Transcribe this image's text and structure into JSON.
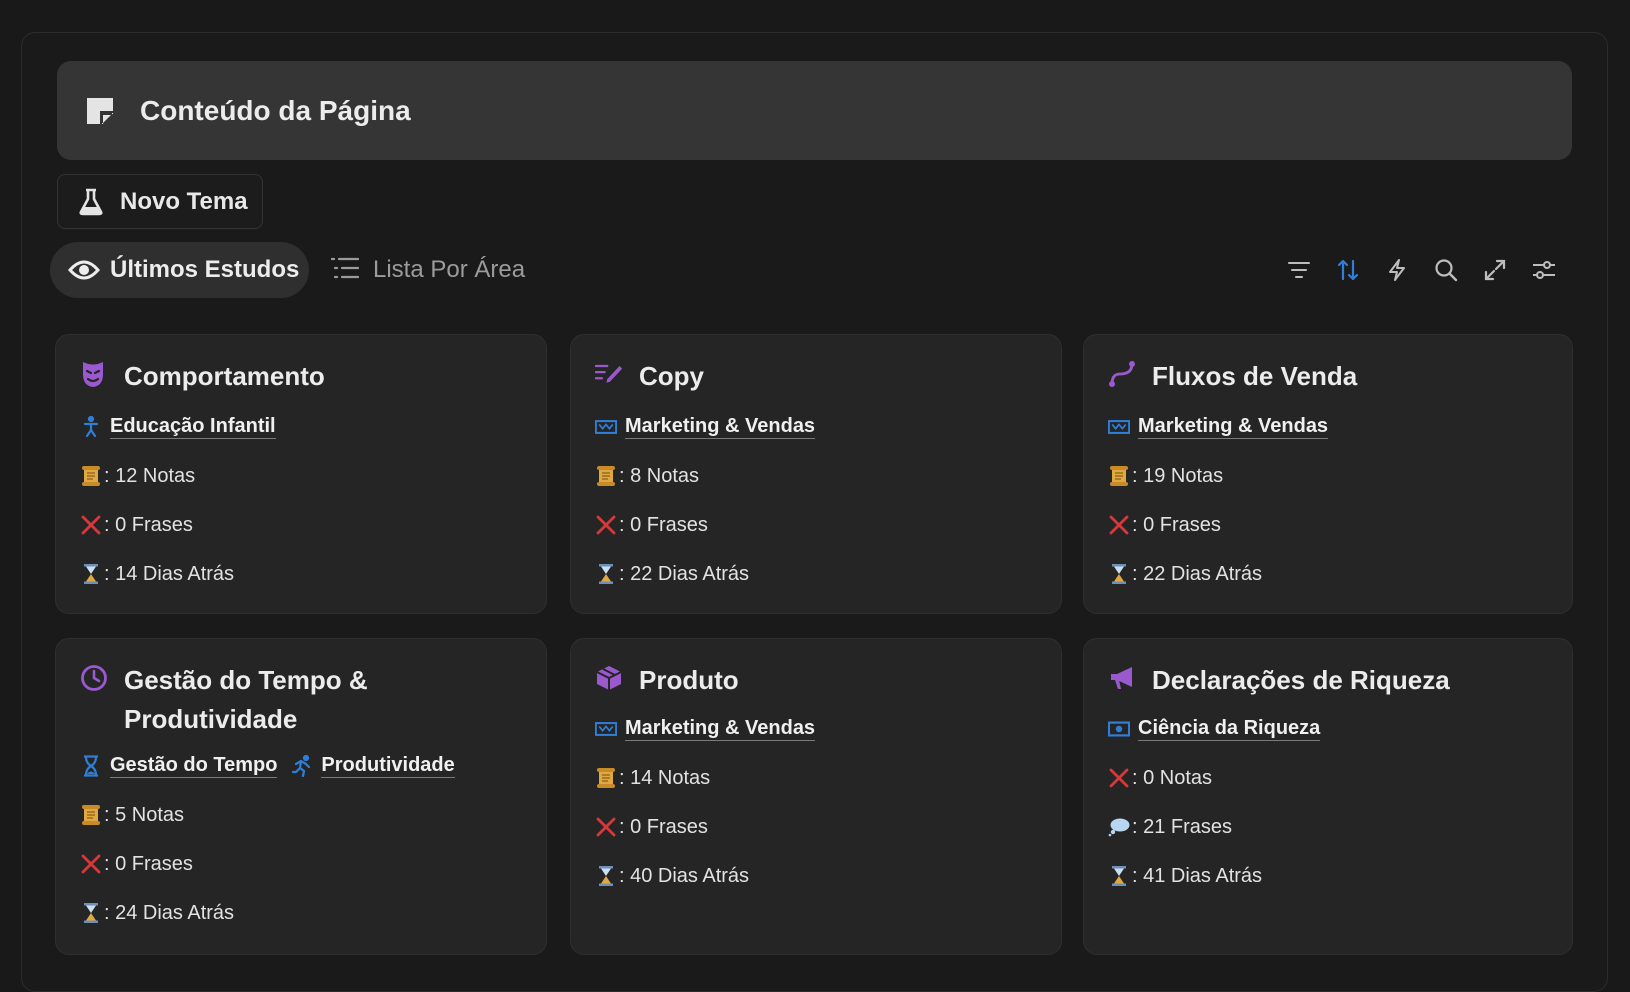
{
  "callout": {
    "title": "Conteúdo da Página",
    "icon": "sticky-note-icon"
  },
  "new_button": {
    "label": "Novo Tema",
    "icon": "flask-icon"
  },
  "tabs": [
    {
      "label": "Últimos Estudos",
      "icon": "eye-icon",
      "active": true
    },
    {
      "label": "Lista Por Área",
      "icon": "list-icon",
      "active": false
    }
  ],
  "toolbar": {
    "icons": [
      "filter-icon",
      "sort-icon",
      "automation-icon",
      "search-icon",
      "expand-icon",
      "settings-icon"
    ],
    "accent": "#2f7fd8"
  },
  "colors": {
    "purple": "#9b59d0",
    "blue": "#2f7fd8",
    "red": "#d8383a",
    "gold": "#e0a840"
  },
  "cards": [
    {
      "title": "Comportamento",
      "icon": "mask-icon",
      "tags": [
        {
          "label": "Educação Infantil",
          "icon": "person-icon"
        }
      ],
      "notes": ": 12 Notas",
      "phrases": ": 0 Frases",
      "days": ": 14 Dias Atrás"
    },
    {
      "title": "Copy",
      "icon": "write-icon",
      "tags": [
        {
          "label": "Marketing & Vendas",
          "icon": "money-icon"
        }
      ],
      "notes": ": 8 Notas",
      "phrases": ": 0 Frases",
      "days": ": 22 Dias Atrás"
    },
    {
      "title": "Fluxos de Venda",
      "icon": "route-icon",
      "tags": [
        {
          "label": "Marketing & Vendas",
          "icon": "money-icon"
        }
      ],
      "notes": ": 19 Notas",
      "phrases": ": 0 Frases",
      "days": ": 22 Dias Atrás"
    },
    {
      "title": "Gestão do Tempo & Produtividade",
      "icon": "clock-icon",
      "tags": [
        {
          "label": "Gestão do Tempo",
          "icon": "hourglass-icon"
        },
        {
          "label": "Produtividade",
          "icon": "runner-icon"
        }
      ],
      "notes": ": 5 Notas",
      "phrases": ": 0 Frases",
      "days": ": 24 Dias Atrás"
    },
    {
      "title": "Produto",
      "icon": "cube-icon",
      "tags": [
        {
          "label": "Marketing & Vendas",
          "icon": "money-icon"
        }
      ],
      "notes": ": 14 Notas",
      "phrases": ": 0 Frases",
      "days": ": 40 Dias Atrás"
    },
    {
      "title": "Declarações de Riqueza",
      "icon": "megaphone-icon",
      "tags": [
        {
          "label": "Ciência da Riqueza",
          "icon": "money-icon"
        }
      ],
      "notes": ": 0 Notas",
      "phrases": ": 21 Frases",
      "days": ": 41 Dias Atrás"
    }
  ]
}
